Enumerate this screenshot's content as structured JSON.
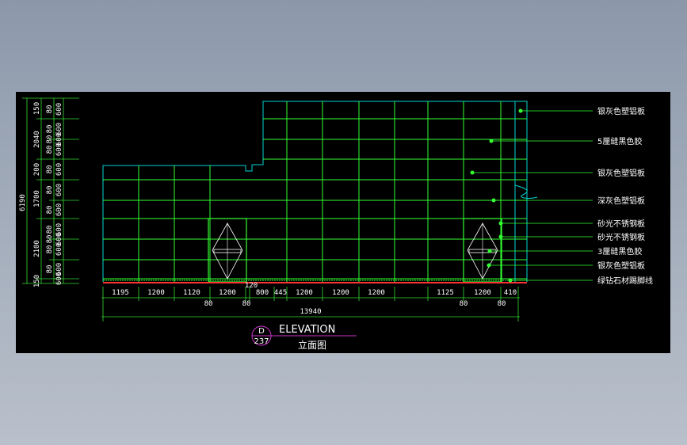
{
  "colors": {
    "background_top": "#8c98aa",
    "canvas": "#000000",
    "grid": "#33ff33",
    "outline": "#00d5d5",
    "base": "#ff3333",
    "title_accent": "#cc33cc"
  },
  "left_dimensions": {
    "total": "6190",
    "segments": [
      "150",
      "2040",
      "200",
      "1700",
      "2100",
      "150"
    ],
    "inner": [
      "80",
      "600",
      "80",
      "600",
      "80",
      "600",
      "80",
      "600",
      "80",
      "600",
      "80",
      "600",
      "80",
      "600",
      "80",
      "600",
      "80",
      "600",
      "80",
      "600",
      "80",
      "600",
      "600"
    ]
  },
  "bottom_dimensions": {
    "segments": [
      "1195",
      "1200",
      "1120",
      "1200",
      "120",
      "800",
      "445",
      "1200",
      "1200",
      "1200",
      "1125",
      "1200",
      "410"
    ],
    "sub_labels": [
      "80",
      "80",
      "80",
      "80"
    ],
    "total": "13940"
  },
  "annotations": [
    "银灰色塑铝板",
    "5厘缝黑色胶",
    "银灰色塑铝板",
    "深灰色塑铝板",
    "砂光不锈钢板",
    "砂光不锈钢板",
    "3厘缝黑色胶",
    "银灰色塑铝板",
    "绿钻石材踢脚线"
  ],
  "title": {
    "code_top": "D",
    "code_bottom": "237",
    "english": "ELEVATION",
    "chinese": "立面图"
  }
}
